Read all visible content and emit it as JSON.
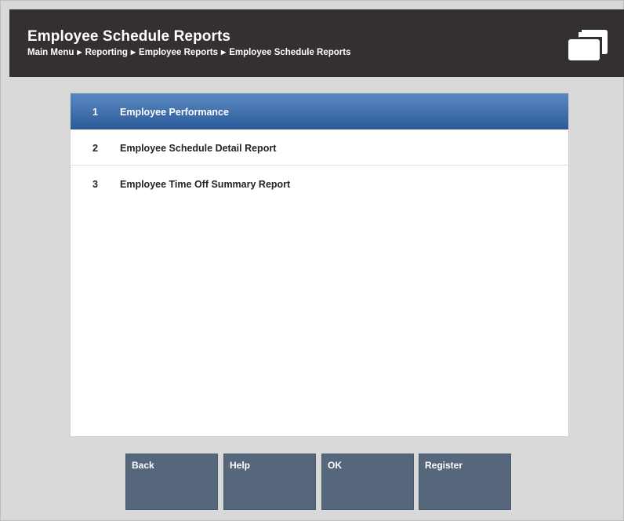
{
  "header": {
    "title": "Employee Schedule Reports",
    "breadcrumb": [
      "Main Menu",
      "Reporting",
      "Employee Reports",
      "Employee Schedule Reports"
    ],
    "icon": "windows-icon"
  },
  "menu": {
    "selected_index": 0,
    "items": [
      {
        "number": "1",
        "label": "Employee Performance"
      },
      {
        "number": "2",
        "label": "Employee Schedule Detail Report"
      },
      {
        "number": "3",
        "label": "Employee Time Off Summary Report"
      }
    ]
  },
  "buttons": {
    "back": "Back",
    "help": "Help",
    "ok": "OK",
    "register": "Register"
  },
  "colors": {
    "header_bg": "#353030",
    "selected_row": "#3d6ca8",
    "button_bg": "#56677c",
    "page_bg": "#d9d9d9"
  }
}
